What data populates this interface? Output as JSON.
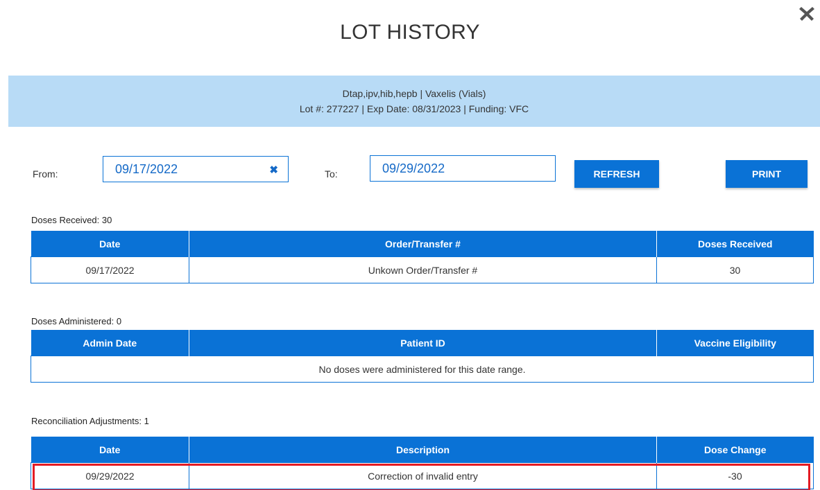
{
  "dialog": {
    "title": "LOT HISTORY"
  },
  "banner": {
    "line1": "Dtap,ipv,hib,hepb  |  Vaxelis (Vials)",
    "line2": "Lot #: 277227  |  Exp Date: 08/31/2023  |  Funding: VFC"
  },
  "filters": {
    "from_label": "From:",
    "from_value": "09/17/2022",
    "clear_icon": "✖",
    "to_label": "To:",
    "to_value": "09/29/2022",
    "refresh_label": "REFRESH",
    "print_label": "PRINT"
  },
  "received": {
    "label": "Doses Received: 30",
    "headers": [
      "Date",
      "Order/Transfer #",
      "Doses Received"
    ],
    "rows": [
      [
        "09/17/2022",
        "Unkown Order/Transfer #",
        "30"
      ]
    ]
  },
  "administered": {
    "label": "Doses Administered: 0",
    "headers": [
      "Admin Date",
      "Patient ID",
      "Vaccine Eligibility"
    ],
    "empty_message": "No doses were administered for this date range."
  },
  "reconciliation": {
    "label": "Reconciliation Adjustments: 1",
    "headers": [
      "Date",
      "Description",
      "Dose Change"
    ],
    "rows": [
      [
        "09/29/2022",
        "Correction of invalid entry",
        "-30"
      ]
    ]
  },
  "colors": {
    "primary": "#0a72d6",
    "banner": "#b8dbf6",
    "highlight": "#e31b23"
  }
}
